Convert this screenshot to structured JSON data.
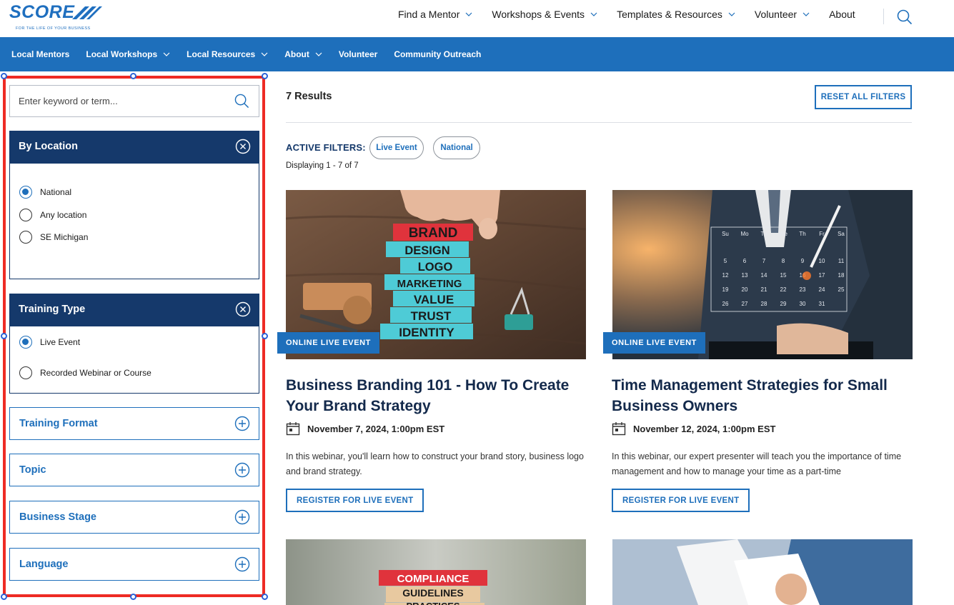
{
  "header": {
    "logo_text": "SCORE",
    "logo_tagline": "FOR THE LIFE OF YOUR BUSINESS",
    "nav": [
      {
        "label": "Find a Mentor"
      },
      {
        "label": "Workshops & Events"
      },
      {
        "label": "Templates & Resources"
      },
      {
        "label": "Volunteer"
      },
      {
        "label": "About"
      }
    ]
  },
  "subnav": {
    "items": [
      {
        "label": "Local Mentors"
      },
      {
        "label": "Local Workshops"
      },
      {
        "label": "Local Resources"
      },
      {
        "label": "About"
      },
      {
        "label": "Volunteer"
      },
      {
        "label": "Community Outreach"
      }
    ]
  },
  "sidebar": {
    "search_placeholder": "Enter keyword or term...",
    "location": {
      "title": "By Location",
      "options": [
        {
          "label": "National",
          "selected": true
        },
        {
          "label": "Any location",
          "selected": false
        },
        {
          "label": "SE Michigan",
          "selected": false
        }
      ]
    },
    "training_type": {
      "title": "Training Type",
      "options": [
        {
          "label": "Live Event",
          "selected": true
        },
        {
          "label": "Recorded Webinar or Course",
          "selected": false
        }
      ]
    },
    "collapsed": [
      {
        "label": "Training Format"
      },
      {
        "label": "Topic"
      },
      {
        "label": "Business Stage"
      },
      {
        "label": "Language"
      }
    ]
  },
  "main": {
    "results_count": "7 Results",
    "reset_label": "RESET ALL FILTERS",
    "active_filters_label": "ACTIVE FILTERS:",
    "chips": [
      "Live Event",
      "National"
    ],
    "displaying": "Displaying 1 - 7 of 7",
    "cards": [
      {
        "badge": "ONLINE LIVE EVENT",
        "title": "Business Branding 101 - How To Create Your Brand Strategy",
        "date": "November 7, 2024, 1:00pm EST",
        "desc": "In this webinar, you'll learn how to construct your brand story, business logo and brand strategy.",
        "button": "REGISTER FOR LIVE EVENT",
        "blocks": [
          "BRAND",
          "DESIGN",
          "LOGO",
          "MARKETING",
          "VALUE",
          "TRUST",
          "IDENTITY"
        ]
      },
      {
        "badge": "ONLINE LIVE EVENT",
        "title": "Time Management Strategies for Small Business Owners",
        "date": "November 12, 2024, 1:00pm EST",
        "desc": "In this webinar, our expert presenter will teach you the importance of time management and how to manage your time as a part-time",
        "button": "REGISTER FOR LIVE EVENT",
        "calendar_head": [
          "Su",
          "Mo",
          "Tu",
          "We",
          "Th",
          "Fr",
          "Sa"
        ],
        "calendar_nums": [
          "5",
          "6",
          "7",
          "8",
          "9",
          "10",
          "11",
          "12",
          "13",
          "14",
          "15",
          "16",
          "17",
          "18",
          "19",
          "20",
          "21",
          "22",
          "23",
          "24",
          "25",
          "26",
          "27",
          "28",
          "29",
          "30",
          "31"
        ]
      },
      {
        "blocks": [
          "COMPLIANCE",
          "GUIDELINES",
          "PRACTICES"
        ]
      },
      {}
    ]
  },
  "colors": {
    "primary_blue": "#1e6fbb",
    "navy": "#15396b",
    "title_navy": "#13294b",
    "selection_red": "#ee2b24",
    "block_teal": "#4ecbd6",
    "block_red": "#e0333c"
  }
}
